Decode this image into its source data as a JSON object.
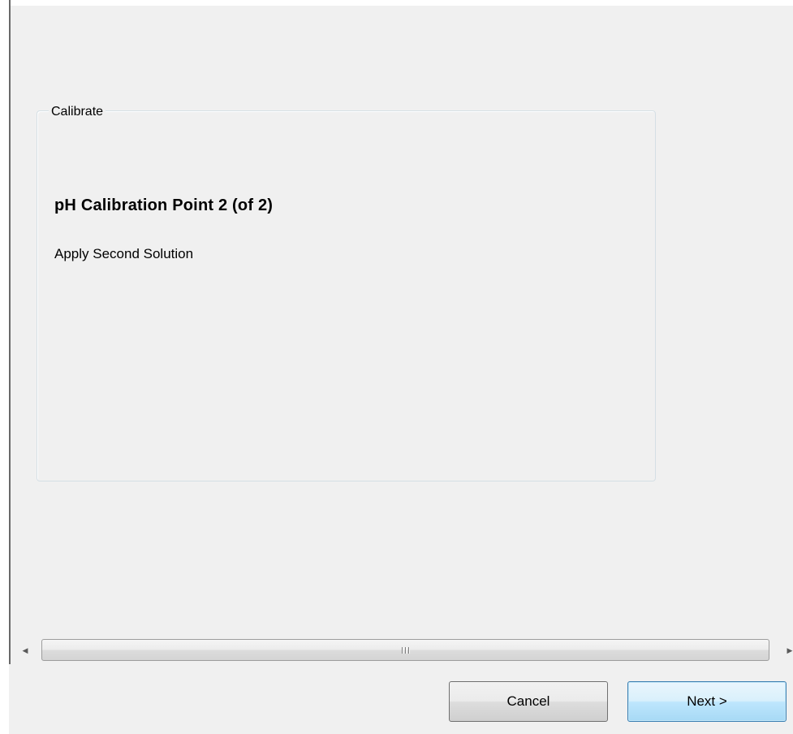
{
  "group": {
    "legend": "Calibrate",
    "title": "pH Calibration Point 2 (of 2)",
    "instruction": "Apply Second Solution"
  },
  "scrollbar": {
    "left_arrow": "◀",
    "right_arrow": "▶"
  },
  "buttons": {
    "cancel": "Cancel",
    "next": "Next >"
  }
}
